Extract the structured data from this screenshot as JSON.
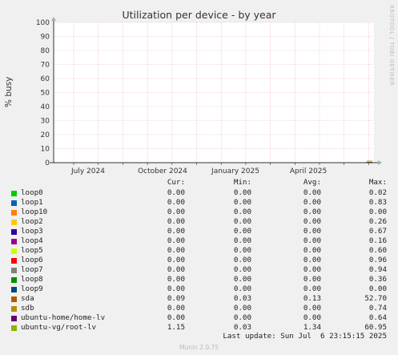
{
  "title": "Utilization per device - by year",
  "side_text": "RRDTOOL / TOBI OETIKER",
  "footer": "Munin 2.0.75",
  "last_update": "Last update: Sun Jul  6 23:15:15 2025",
  "legend_header": {
    "cur": "Cur:",
    "min": "Min:",
    "avg": "Avg:",
    "max": "Max:"
  },
  "colors": {
    "background": "#f0f0f0",
    "plot_bg": "#ffffff",
    "grid_minor": "#f2c6c6",
    "grid_major": "#e38b8b",
    "axis": "#333333"
  },
  "chart_data": {
    "type": "line",
    "title": "Utilization per device - by year",
    "ylabel": "% busy",
    "xlabel": "",
    "ylim": [
      0,
      100
    ],
    "y_ticks": [
      "0",
      "10",
      "20",
      "30",
      "40",
      "50",
      "60",
      "70",
      "80",
      "90",
      "100"
    ],
    "x_ticks": [
      "July 2024",
      "October 2024",
      "January 2025",
      "April 2025"
    ],
    "grid": true,
    "legend_placement": "bottom",
    "series": [
      {
        "name": "loop0",
        "color": "#00cc00",
        "cur": "0.00",
        "min": "0.00",
        "avg": "0.00",
        "max": "0.02"
      },
      {
        "name": "loop1",
        "color": "#0066b3",
        "cur": "0.00",
        "min": "0.00",
        "avg": "0.00",
        "max": "0.83"
      },
      {
        "name": "loop10",
        "color": "#ff8000",
        "cur": "0.00",
        "min": "0.00",
        "avg": "0.00",
        "max": "0.00"
      },
      {
        "name": "loop2",
        "color": "#ffcc00",
        "cur": "0.00",
        "min": "0.00",
        "avg": "0.00",
        "max": "0.26"
      },
      {
        "name": "loop3",
        "color": "#330099",
        "cur": "0.00",
        "min": "0.00",
        "avg": "0.00",
        "max": "0.67"
      },
      {
        "name": "loop4",
        "color": "#990099",
        "cur": "0.00",
        "min": "0.00",
        "avg": "0.00",
        "max": "0.16"
      },
      {
        "name": "loop5",
        "color": "#ccff00",
        "cur": "0.00",
        "min": "0.00",
        "avg": "0.00",
        "max": "0.60"
      },
      {
        "name": "loop6",
        "color": "#ff0000",
        "cur": "0.00",
        "min": "0.00",
        "avg": "0.00",
        "max": "0.96"
      },
      {
        "name": "loop7",
        "color": "#808080",
        "cur": "0.00",
        "min": "0.00",
        "avg": "0.00",
        "max": "0.94"
      },
      {
        "name": "loop8",
        "color": "#008f00",
        "cur": "0.00",
        "min": "0.00",
        "avg": "0.00",
        "max": "0.36"
      },
      {
        "name": "loop9",
        "color": "#00487d",
        "cur": "0.00",
        "min": "0.00",
        "avg": "0.00",
        "max": "0.00"
      },
      {
        "name": "sda",
        "color": "#b35a00",
        "cur": "0.09",
        "min": "0.03",
        "avg": "0.13",
        "max": "52.70"
      },
      {
        "name": "sdb",
        "color": "#b38f00",
        "cur": "0.00",
        "min": "0.00",
        "avg": "0.00",
        "max": "0.74"
      },
      {
        "name": "ubuntu-home/home-lv",
        "color": "#6b006b",
        "cur": "0.00",
        "min": "0.00",
        "avg": "0.00",
        "max": "0.64"
      },
      {
        "name": "ubuntu-vg/root-lv",
        "color": "#8fb300",
        "cur": "1.15",
        "min": "0.03",
        "avg": "1.34",
        "max": "60.95"
      }
    ]
  }
}
